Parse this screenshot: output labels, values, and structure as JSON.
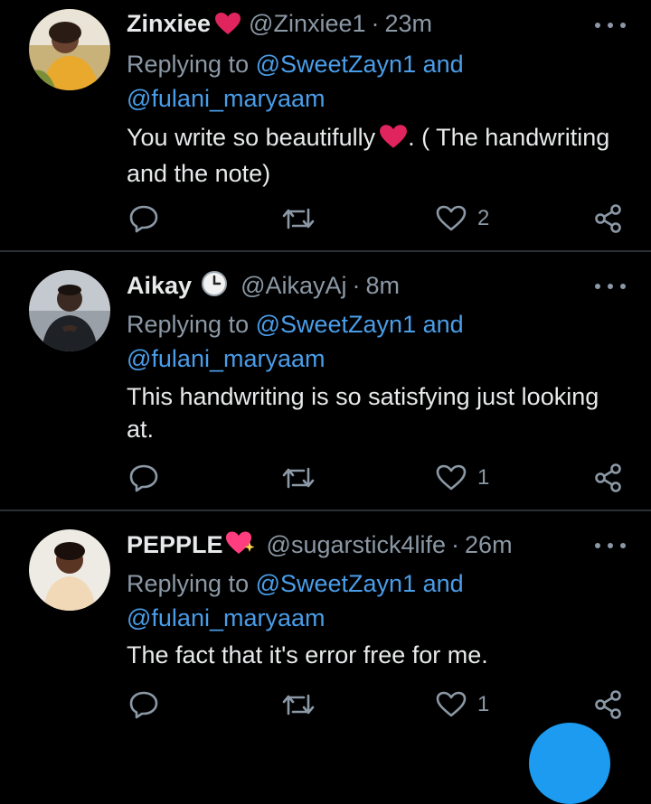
{
  "tweets": [
    {
      "name": "Zinxiee",
      "badge": "heart-emoji",
      "handle": "@Zinxiee1",
      "separator": "·",
      "time": "23m",
      "replying_prefix": "Replying to ",
      "mention1": "@SweetZayn1",
      "and": " and",
      "mention2": "@fulani_maryaam",
      "text_part1": "You write so beautifully",
      "text_emoji": "heart-emoji",
      "text_part2": ". ( The handwriting and the note)",
      "likes": "2"
    },
    {
      "name": "Aikay",
      "badge": "clock-emoji",
      "handle": "@AikayAj",
      "separator": "·",
      "time": "8m",
      "replying_prefix": "Replying to ",
      "mention1": "@SweetZayn1",
      "and": " and",
      "mention2": "@fulani_maryaam",
      "text": "This handwriting is so satisfying just looking at.",
      "likes": "1"
    },
    {
      "name": "PEPPLE",
      "badge": "sparkling-heart-emoji",
      "handle": "@sugarstick4life",
      "separator": "·",
      "time": "26m",
      "replying_prefix": "Replying to ",
      "mention1": "@SweetZayn1",
      "and": " and",
      "mention2": "@fulani_maryaam",
      "text": "The fact that it's error free for me.",
      "likes": "1"
    }
  ],
  "colors": {
    "background": "#000000",
    "name": "#e7e9ea",
    "muted": "#8b98a5",
    "mention": "#4a9de8",
    "fab": "#1d9bf0",
    "heart": "#e0245e"
  }
}
